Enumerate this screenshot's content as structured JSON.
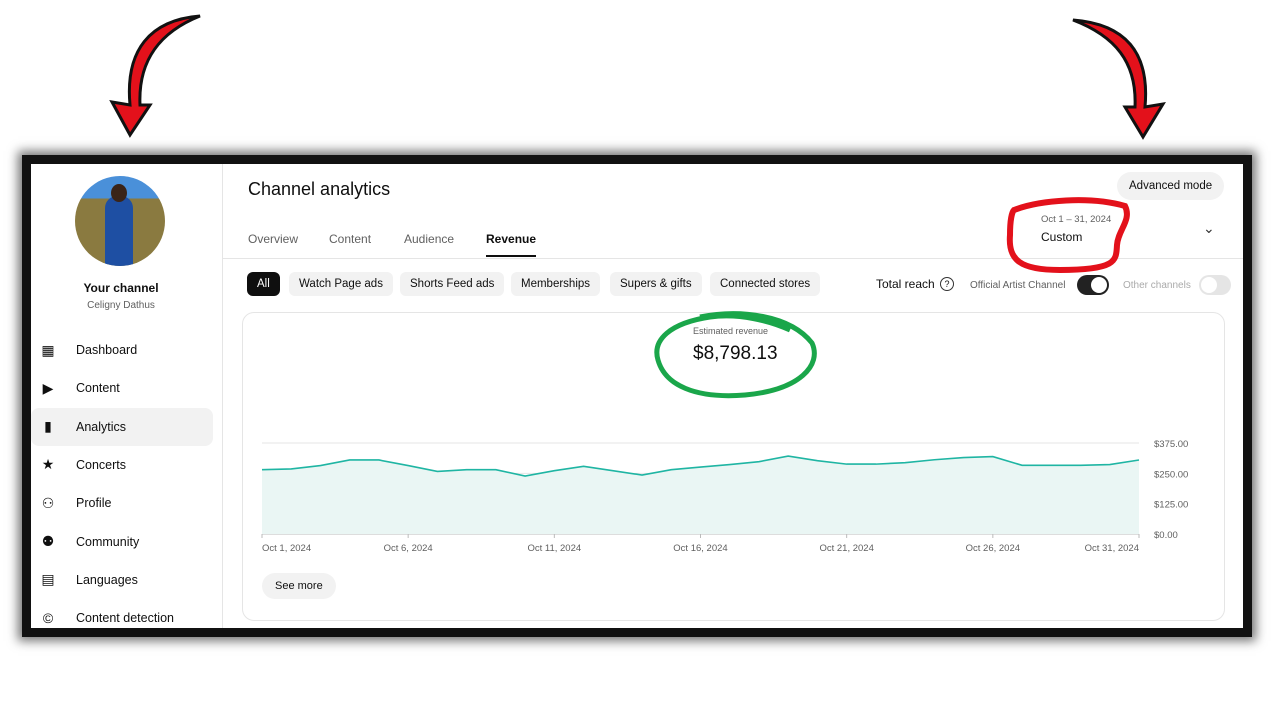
{
  "header": {
    "title": "Channel analytics",
    "advanced_mode": "Advanced mode",
    "date_range": "Oct 1 – 31, 2024",
    "date_preset": "Custom"
  },
  "tabs": [
    "Overview",
    "Content",
    "Audience",
    "Revenue"
  ],
  "active_tab": "Revenue",
  "sidebar": {
    "channel_label": "Your channel",
    "channel_name": "Celigny Dathus",
    "items": [
      {
        "label": "Dashboard",
        "icon": "dashboard-icon"
      },
      {
        "label": "Content",
        "icon": "content-icon"
      },
      {
        "label": "Analytics",
        "icon": "analytics-icon",
        "active": true
      },
      {
        "label": "Concerts",
        "icon": "ticket-icon"
      },
      {
        "label": "Profile",
        "icon": "person-icon"
      },
      {
        "label": "Community",
        "icon": "people-icon"
      },
      {
        "label": "Languages",
        "icon": "subtitles-icon"
      },
      {
        "label": "Content detection",
        "icon": "copyright-icon"
      }
    ]
  },
  "chips": [
    "All",
    "Watch Page ads",
    "Shorts Feed ads",
    "Memberships",
    "Supers & gifts",
    "Connected stores"
  ],
  "reach": {
    "label": "Total reach",
    "official": "Official Artist Channel",
    "official_on": true,
    "other": "Other channels",
    "other_on": false
  },
  "metric": {
    "label": "Estimated revenue",
    "value": "$8,798.13"
  },
  "see_more": "See more",
  "colors": {
    "line": "#1fb5a3",
    "fill": "#eaf6f4",
    "annotation_red": "#e3111b",
    "annotation_green": "#1aa64a"
  },
  "chart_data": {
    "type": "area",
    "ylim": [
      0,
      375
    ],
    "yticks": [
      "$375.00",
      "$250.00",
      "$125.00",
      "$0.00"
    ],
    "ytick_values": [
      375,
      250,
      125,
      0
    ],
    "xticks": [
      "Oct 1, 2024",
      "Oct 6, 2024",
      "Oct 11, 2024",
      "Oct 16, 2024",
      "Oct 21, 2024",
      "Oct 26, 2024",
      "Oct 31, 2024"
    ],
    "x": [
      "Oct 1",
      "Oct 2",
      "Oct 3",
      "Oct 4",
      "Oct 5",
      "Oct 6",
      "Oct 7",
      "Oct 8",
      "Oct 9",
      "Oct 10",
      "Oct 11",
      "Oct 12",
      "Oct 13",
      "Oct 14",
      "Oct 15",
      "Oct 16",
      "Oct 17",
      "Oct 18",
      "Oct 19",
      "Oct 20",
      "Oct 21",
      "Oct 22",
      "Oct 23",
      "Oct 24",
      "Oct 25",
      "Oct 26",
      "Oct 27",
      "Oct 28",
      "Oct 29",
      "Oct 30",
      "Oct 31"
    ],
    "values": [
      265,
      268,
      282,
      305,
      305,
      282,
      258,
      265,
      265,
      239,
      261,
      279,
      261,
      243,
      265,
      276,
      286,
      298,
      321,
      302,
      288,
      288,
      294,
      306,
      315,
      319,
      283,
      283,
      283,
      286,
      305
    ],
    "grid": true
  }
}
